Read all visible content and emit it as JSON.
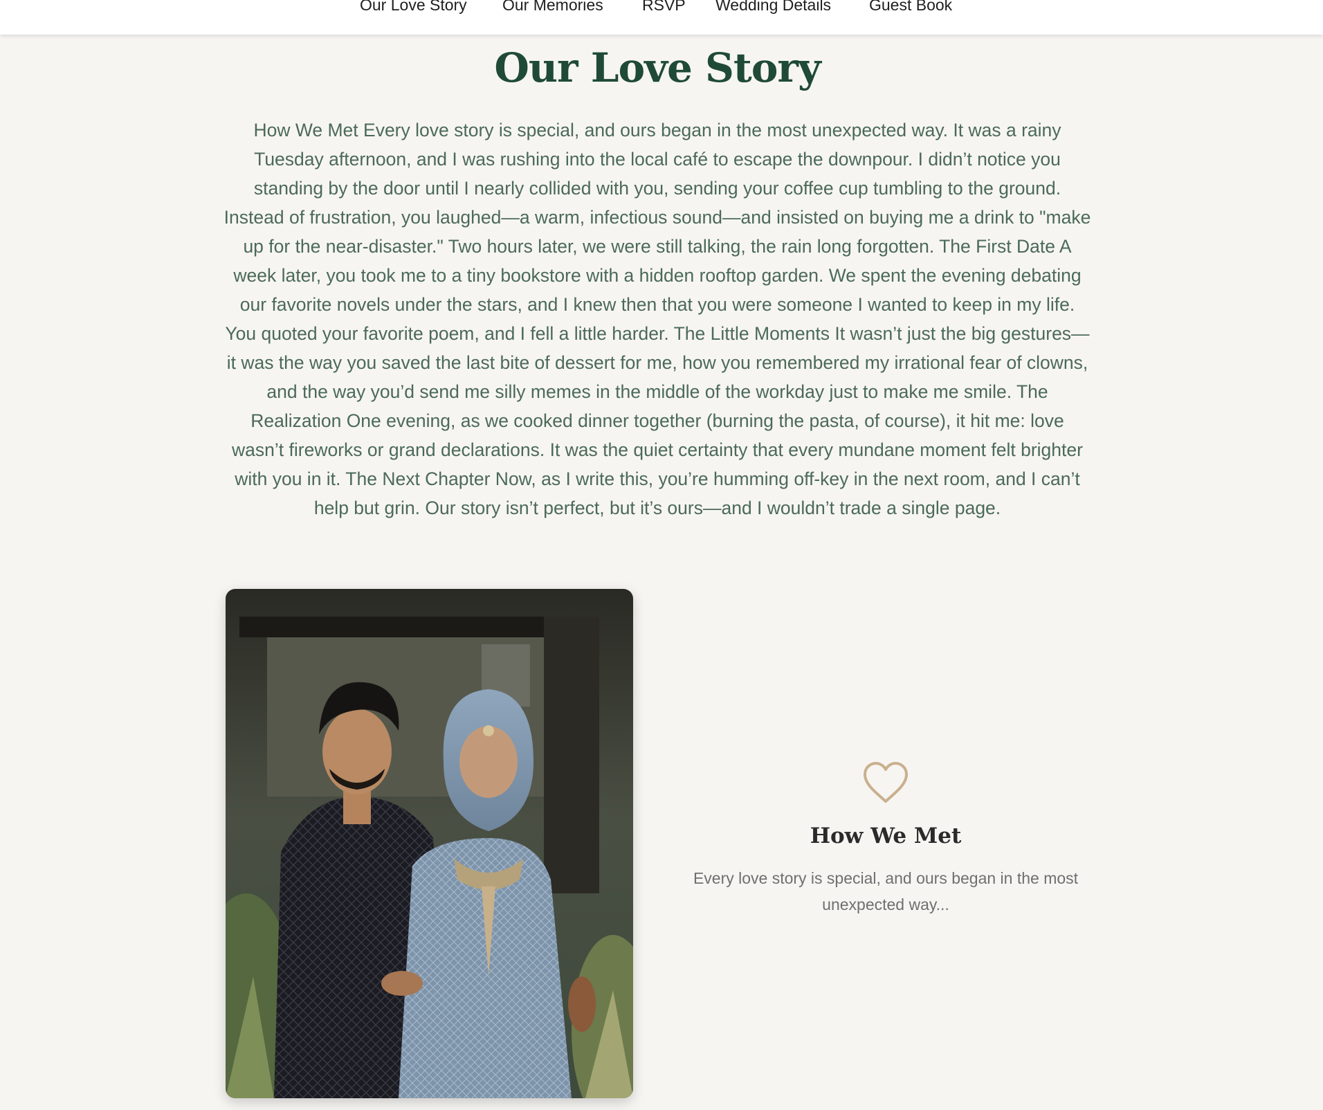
{
  "nav": {
    "items": [
      {
        "label": "Our Love Story"
      },
      {
        "label": "Our Memories"
      },
      {
        "label": "RSVP"
      },
      {
        "label": "Wedding Details"
      },
      {
        "label": "Guest Book"
      }
    ]
  },
  "story": {
    "title": "Our Love Story",
    "body": "How We Met Every love story is special, and ours began in the most unexpected way. It was a rainy Tuesday afternoon, and I was rushing into the local café to escape the downpour. I didn’t notice you standing by the door until I nearly collided with you, sending your coffee cup tumbling to the ground. Instead of frustration, you laughed—a warm, infectious sound—and insisted on buying me a drink to \"make up for the near-disaster.\" Two hours later, we were still talking, the rain long forgotten. The First Date A week later, you took me to a tiny bookstore with a hidden rooftop garden. We spent the evening debating our favorite novels under the stars, and I knew then that you were someone I wanted to keep in my life. You quoted your favorite poem, and I fell a little harder. The Little Moments It wasn’t just the big gestures—it was the way you saved the last bite of dessert for me, how you remembered my irrational fear of clowns, and the way you’d send me silly memes in the middle of the workday just to make me smile. The Realization One evening, as we cooked dinner together (burning the pasta, of course), it hit me: love wasn’t fireworks or grand declarations. It was the quiet certainty that every mundane moment felt brighter with you in it. The Next Chapter Now, as I write this, you’re humming off-key in the next room, and I can’t help but grin. Our story isn’t perfect, but it’s ours—and I wouldn’t trade a single page."
  },
  "feature": {
    "icon": "heart-outline-icon",
    "title": "How We Met",
    "text": "Every love story is special, and ours began in the most unexpected way..."
  },
  "colors": {
    "page_bg": "#f7f5f2",
    "title_green": "#1f4a36",
    "body_green": "#4b6a58",
    "heart_gold": "#c9b08e"
  }
}
